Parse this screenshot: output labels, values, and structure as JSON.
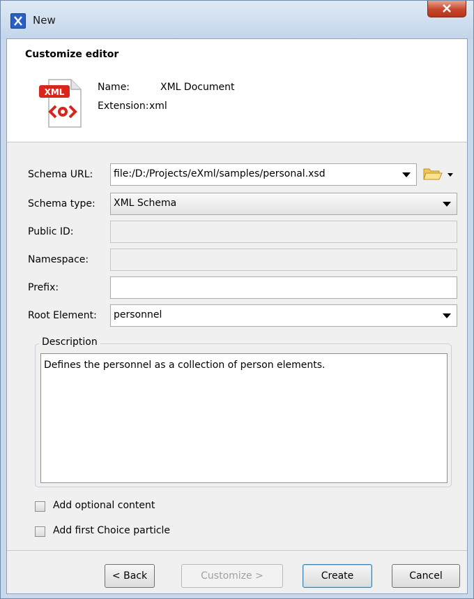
{
  "window": {
    "title": "New",
    "close_glyph": "X"
  },
  "header": {
    "title": "Customize editor",
    "icon_badge": "XML",
    "name_label": "Name:",
    "name_value": "XML Document",
    "extension_label": "Extension:",
    "extension_value": "xml"
  },
  "form": {
    "schema_url_label": "Schema URL:",
    "schema_url_value": "file:/D:/Projects/eXml/samples/personal.xsd",
    "schema_type_label": "Schema type:",
    "schema_type_value": "XML Schema",
    "public_id_label": "Public ID:",
    "public_id_value": "",
    "namespace_label": "Namespace:",
    "namespace_value": "",
    "prefix_label": "Prefix:",
    "prefix_value": "",
    "root_element_label": "Root Element:",
    "root_element_value": "personnel",
    "description_legend": "Description",
    "description_text": "Defines the personnel as a collection of person elements.",
    "optional_content_label": "Add optional content",
    "optional_content_checked": false,
    "first_choice_label": "Add first Choice particle",
    "first_choice_checked": false
  },
  "buttons": {
    "back": "< Back",
    "customize": "Customize >",
    "create": "Create",
    "cancel": "Cancel"
  },
  "icons": [
    "app-icon",
    "close-icon",
    "xml-document-icon",
    "folder-open-icon",
    "chevron-down-icon"
  ],
  "colors": {
    "xml_badge": "#d9261c",
    "title_bar": "#c3d5ea",
    "close_button": "#c7452a"
  }
}
